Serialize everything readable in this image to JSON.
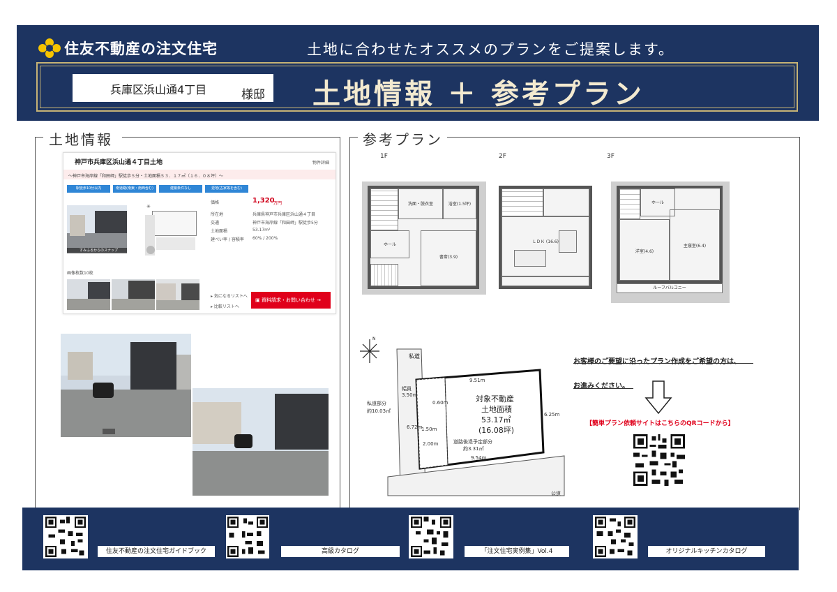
{
  "header": {
    "brand": "住友不動産の注文住宅",
    "tagline": "土地に合わせたオススメのプランをご提案します。",
    "customer_name": "兵庫区浜山通4丁目",
    "customer_suffix": "様邸",
    "title": "土地情報 ＋ 参考プラン"
  },
  "land_section": {
    "title": "土地情報",
    "listing": {
      "heading": "神戸市兵庫区浜山通４丁目土地",
      "link": "物件詳細",
      "subline": "～神戸市海岸線「和田岬」駅徒歩５分・土地面積５３．１７㎡（１６．０８坪）～",
      "tags": [
        "駅徒歩10分以内",
        "南道路(南東・南西含む)",
        "建築条件なし",
        "更地(古家等を含む)"
      ],
      "photo_caption": "すみふるからのスナップ",
      "details": [
        {
          "key": "価格",
          "value": "1,320",
          "unit": "万円"
        },
        {
          "key": "所在地",
          "value": "兵庫県神戸市兵庫区浜山通４丁目"
        },
        {
          "key": "交通",
          "value": "神戸市海岸線「和田岬」駅徒歩5分"
        },
        {
          "key": "土地面積",
          "value": "53.17m²"
        },
        {
          "key": "建ぺい率 / 容積率",
          "value": "60% / 200%"
        }
      ],
      "gallery_label": "画像枚数10枚",
      "favorite_link": "気になるリストへ",
      "compare_link": "比較リストへ",
      "inquiry_button": "資料請求・お問い合わせ"
    }
  },
  "plan_section": {
    "title": "参考プラン",
    "floors": [
      {
        "label": "1F",
        "rooms": [
          "ホール",
          "洗面・脱衣室",
          "浴室(1.5坪)",
          "書斎(3.9)"
        ]
      },
      {
        "label": "2F",
        "rooms": [
          "ＬＤＫ (16.6)"
        ]
      },
      {
        "label": "3F",
        "rooms": [
          "ホール",
          "洋室(4.6)",
          "主寝室(6.4)",
          "ルーフバルコニー"
        ]
      }
    ],
    "site": {
      "lot_title": "対象不動産",
      "lot_sub": "土地面積",
      "area_m2": "53.17㎡",
      "area_tsubo": "(16.08坪)",
      "private_road": "私道",
      "private_share": "私道部分",
      "private_share_area": "約10.03㎡",
      "road_width_label": "幅員",
      "road_width": "3.50m",
      "setback_label": "道路後退予定部分",
      "setback_area": "約3.31㎡",
      "dim_top": "9.51m",
      "dim_bottom": "9.54m",
      "dim_right": "6.25m",
      "dim_left": "6.72m",
      "dim_setback": "0.60m",
      "dim_150": "1.50m",
      "dim_200": "2.00m",
      "public_road": "公道"
    },
    "cta_line1": "お客様のご要望に沿ったプラン作成をご希望の方は、",
    "cta_line2": "お進みください。",
    "cta_link": "【簡単プラン依頼サイトはこちらのQRコードから】"
  },
  "footer": {
    "items": [
      {
        "label": "住友不動産の注文住宅ガイドブック"
      },
      {
        "label": "高級カタログ"
      },
      {
        "label": "「注文住宅実例集」Vol.4"
      },
      {
        "label": "オリジナルキッチンカタログ"
      }
    ]
  },
  "colors": {
    "navy": "#1d3461",
    "gold": "#c7b375",
    "cta_red": "#e0001b",
    "price_red": "#d0021b",
    "tag_blue": "#2f86d6"
  }
}
